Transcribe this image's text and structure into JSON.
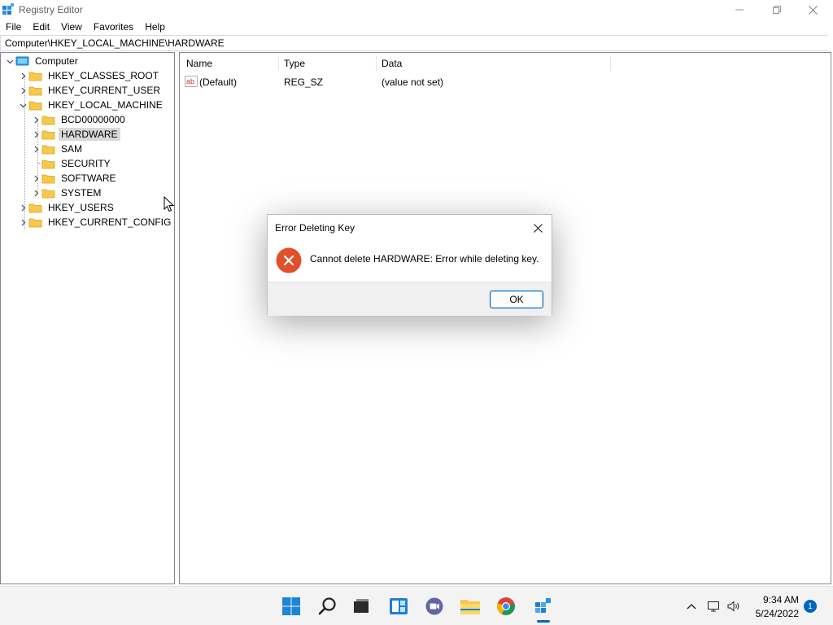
{
  "window": {
    "title": "Registry Editor",
    "app_icon": "regedit-icon",
    "controls": [
      "minimize-icon",
      "maximize-icon",
      "close-icon"
    ]
  },
  "menu": [
    "File",
    "Edit",
    "View",
    "Favorites",
    "Help"
  ],
  "address": "Computer\\HKEY_LOCAL_MACHINE\\HARDWARE",
  "tree": {
    "root": "Computer",
    "hives": [
      "HKEY_CLASSES_ROOT",
      "HKEY_CURRENT_USER",
      "HKEY_LOCAL_MACHINE",
      "HKEY_USERS",
      "HKEY_CURRENT_CONFIG"
    ],
    "hklm_children": [
      "BCD00000000",
      "HARDWARE",
      "SAM",
      "SECURITY",
      "SOFTWARE",
      "SYSTEM"
    ],
    "selected": "HARDWARE"
  },
  "list": {
    "columns": [
      "Name",
      "Type",
      "Data"
    ],
    "rows": [
      {
        "name": "(Default)",
        "type": "REG_SZ",
        "data": "(value not set)",
        "icon": "string-value-icon"
      }
    ]
  },
  "dialog": {
    "title": "Error Deleting Key",
    "message": "Cannot delete HARDWARE:  Error while deleting key.",
    "ok_label": "OK",
    "icon": "error-icon"
  },
  "taskbar": {
    "apps": [
      "start-icon",
      "search-icon",
      "task-view-icon",
      "widgets-icon",
      "chat-icon",
      "file-explorer-icon",
      "chrome-icon",
      "regedit-icon"
    ],
    "time": "9:34 AM",
    "date": "5/24/2022",
    "notification_count": "1"
  },
  "colors": {
    "accent": "#0067c0",
    "error": "#e0502a",
    "folder": "#f8c84a",
    "selection": "#d9d9d9"
  }
}
